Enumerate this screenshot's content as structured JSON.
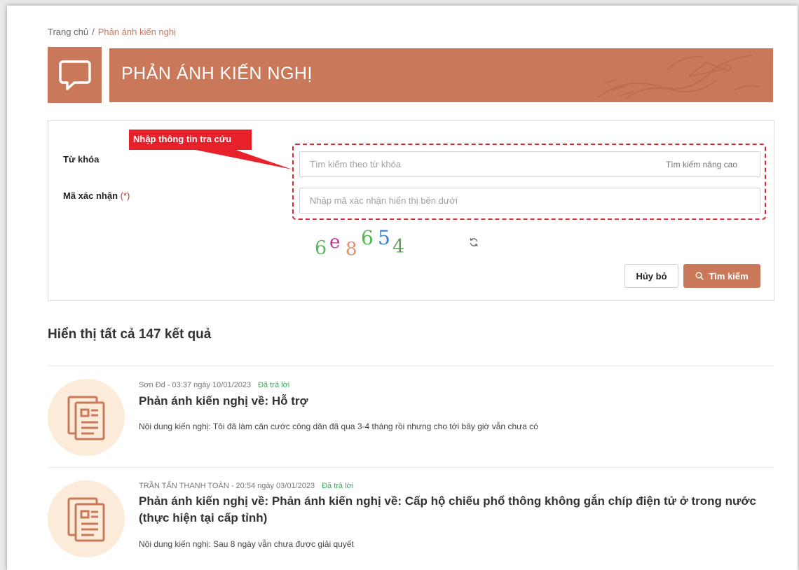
{
  "breadcrumb": {
    "home": "Trang chủ",
    "separator": "/",
    "current": "Phản ánh kiến nghị"
  },
  "banner": {
    "title": "PHẢN ÁNH KIẾN NGHỊ",
    "icon": "chat-bubble-icon"
  },
  "search": {
    "callout": "Nhập thông tin tra cứu",
    "keyword_label": "Từ khóa",
    "keyword_placeholder": "Tìm kiếm theo từ khóa",
    "advanced_link": "Tìm kiếm nâng cao",
    "captcha_label": "Mã xác nhận",
    "captcha_required": "(*)",
    "captcha_placeholder": "Nhập mã xác nhận hiển thị bên dưới",
    "captcha_chars": [
      "6",
      "e",
      "8",
      "6",
      "5",
      "4"
    ],
    "cancel_label": "Hủy bỏ",
    "search_label": "Tìm kiếm"
  },
  "results": {
    "heading": "Hiển thị tất cả 147 kết quả",
    "items": [
      {
        "meta": "Sơn Đd - 03:37 ngày 10/01/2023",
        "status": "Đã trả lời",
        "title": "Phản ánh kiến nghị về: Hỗ trợ",
        "content": "Nội dung kiến nghị: Tôi đã làm căn cước công dân đã qua 3-4 tháng rồi nhưng cho tới bây giờ vẫn chưa có"
      },
      {
        "meta": "TRẦN TẤN THANH TOÀN - 20:54 ngày 03/01/2023",
        "status": "Đã trả lời",
        "title": "Phản ánh kiến nghị về: Phản ánh kiến nghị về: Cấp hộ chiếu phổ thông không gắn chíp điện tử ở trong nước (thực hiện tại cấp tỉnh)",
        "content": "Nội dung kiến nghị: Sau 8 ngày vẫn chưa được giải quyết"
      }
    ]
  },
  "colors": {
    "brand": "#c9795a",
    "callout": "#e8202a",
    "status_answered": "#3caa5a",
    "avatar_bg": "#fdebd9"
  }
}
